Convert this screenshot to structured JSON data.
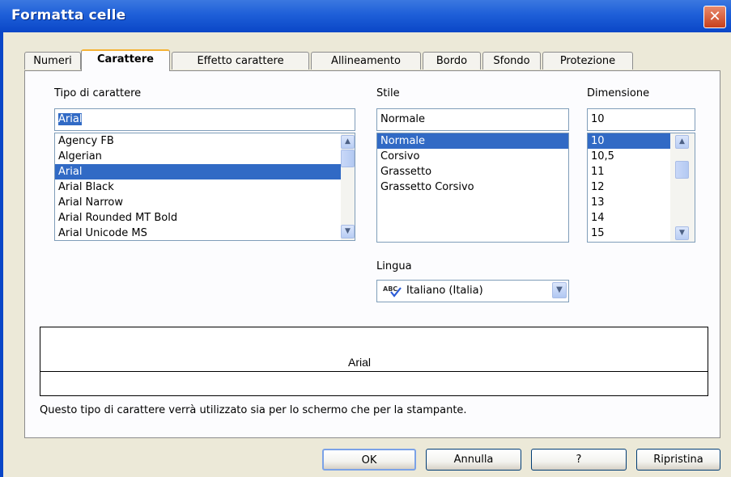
{
  "window": {
    "title": "Formatta celle",
    "close_label": "✕"
  },
  "tabs": [
    {
      "label": "Numeri"
    },
    {
      "label": "Carattere"
    },
    {
      "label": "Effetto carattere"
    },
    {
      "label": "Allineamento"
    },
    {
      "label": "Bordo"
    },
    {
      "label": "Sfondo"
    },
    {
      "label": "Protezione"
    }
  ],
  "active_tab": "Carattere",
  "font": {
    "label": "Tipo di carattere",
    "value": "Arial",
    "items": [
      "Agency FB",
      "Algerian",
      "Arial",
      "Arial Black",
      "Arial Narrow",
      "Arial Rounded MT Bold",
      "Arial Unicode MS"
    ],
    "selected": "Arial"
  },
  "style": {
    "label": "Stile",
    "value": "Normale",
    "items": [
      "Normale",
      "Corsivo",
      "Grassetto",
      "Grassetto Corsivo"
    ],
    "selected": "Normale"
  },
  "size": {
    "label": "Dimensione",
    "value": "10",
    "items": [
      "10",
      "10,5",
      "11",
      "12",
      "13",
      "14",
      "15"
    ],
    "selected": "10"
  },
  "language": {
    "label": "Lingua",
    "value": "Italiano (Italia)",
    "icon": "spellcheck-icon"
  },
  "preview": {
    "text": "Arial"
  },
  "info_text": "Questo tipo di carattere verrà utilizzato sia per lo schermo che per la stampante.",
  "buttons": {
    "ok": "OK",
    "cancel": "Annulla",
    "help": "?",
    "reset": "Ripristina"
  },
  "colors": {
    "title_bar": "#0a46c7",
    "selection": "#316ac5",
    "active_tab_accent": "#f5b234",
    "dialog_bg": "#ece9d8"
  }
}
